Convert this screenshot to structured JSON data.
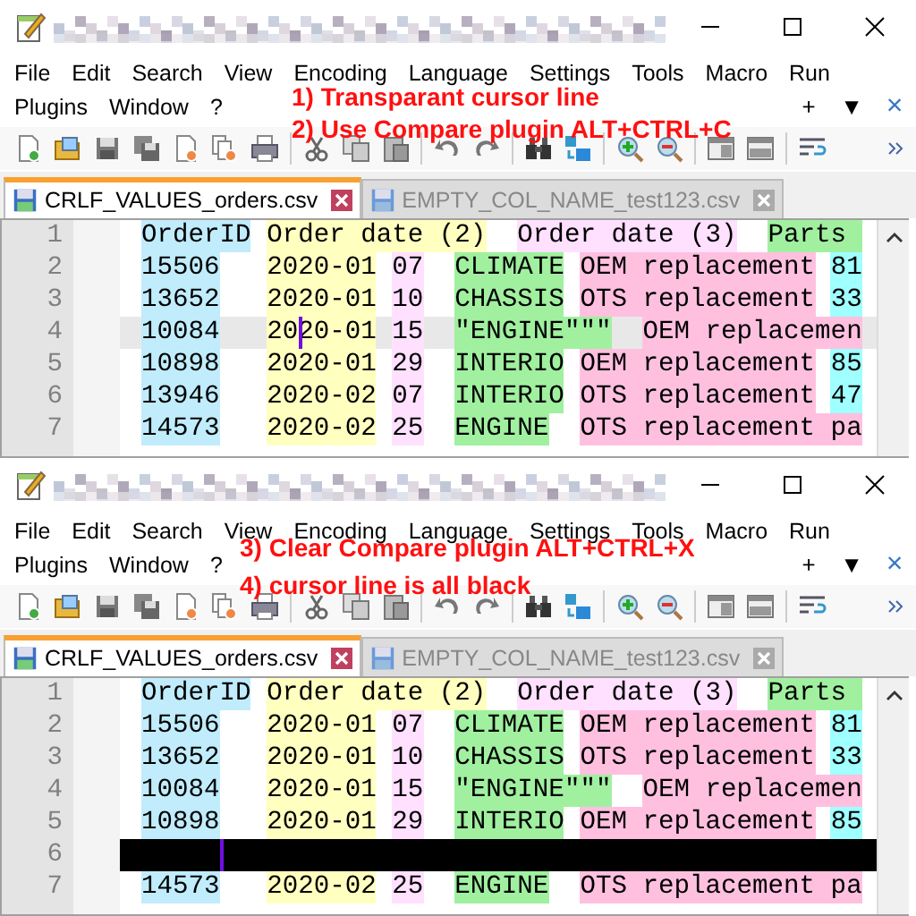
{
  "panes": [
    {
      "menu_rows": [
        [
          "File",
          "Edit",
          "Search",
          "View",
          "Encoding",
          "Language",
          "Settings",
          "Tools",
          "Macro",
          "Run"
        ],
        [
          "Plugins",
          "Window",
          "?"
        ]
      ],
      "menu_right": [
        "+",
        "▼",
        "×"
      ],
      "annotations": [
        "1) Transparant cursor line",
        "2) Use Compare plugin ALT+CTRL+C"
      ],
      "tabs": [
        {
          "label": "CRLF_VALUES_orders.csv",
          "selected": true
        },
        {
          "label": "EMPTY_COL_NAME_test123.csv",
          "selected": false
        }
      ],
      "editor": {
        "cursor_line_black": false,
        "rows": [
          {
            "number": "1",
            "current": false,
            "runs": [
              {
                "text": "OrderID",
                "color": "#c0ecfc"
              },
              {
                "text": " Order date (2)",
                "color": "#ffffc0"
              },
              {
                "text": "  Order date (3)",
                "color": "#ffe0ff"
              },
              {
                "text": "  Parts ",
                "color": "#a0f0a0"
              }
            ]
          },
          {
            "number": "2",
            "current": false,
            "runs": [
              {
                "text": "15506",
                "color": "#c0ecfc"
              },
              {
                "text": "   2020-01",
                "color": "#ffffc0"
              },
              {
                "text": " 07",
                "color": "#ffe0ff"
              },
              {
                "text": "  CLIMATE",
                "color": "#a0f0a0"
              },
              {
                "text": " OEM replacement",
                "color": "#ffc0e0"
              },
              {
                "text": " 81",
                "color": "#a0ffff"
              }
            ]
          },
          {
            "number": "3",
            "current": false,
            "runs": [
              {
                "text": "13652",
                "color": "#c0ecfc"
              },
              {
                "text": "   2020-01",
                "color": "#ffffc0"
              },
              {
                "text": " 10",
                "color": "#ffe0ff"
              },
              {
                "text": "  CHASSIS",
                "color": "#a0f0a0"
              },
              {
                "text": " OTS replacement",
                "color": "#ffc0e0"
              },
              {
                "text": " 33",
                "color": "#a0ffff"
              }
            ]
          },
          {
            "number": "4",
            "current": true,
            "runs": [
              {
                "text": "10084",
                "color": "#c0ecfc"
              },
              {
                "text": "   20",
                "color": "#ffffc0"
              },
              {
                "kind": "caret"
              },
              {
                "text": "20-01",
                "color": "#ffffc0"
              },
              {
                "text": " 15",
                "color": "#ffe0ff"
              },
              {
                "text": "  \"ENGINE\"\"\"",
                "color": "#a0f0a0"
              },
              {
                "text": "  OEM replacemen",
                "color": "#ffc0e0"
              }
            ]
          },
          {
            "number": "5",
            "current": false,
            "runs": [
              {
                "text": "10898",
                "color": "#c0ecfc"
              },
              {
                "text": "   2020-01",
                "color": "#ffffc0"
              },
              {
                "text": " 29",
                "color": "#ffe0ff"
              },
              {
                "text": "  INTERIO",
                "color": "#a0f0a0"
              },
              {
                "text": " OEM replacement",
                "color": "#ffc0e0"
              },
              {
                "text": " 85",
                "color": "#a0ffff"
              }
            ]
          },
          {
            "number": "6",
            "current": false,
            "runs": [
              {
                "text": "13946",
                "color": "#c0ecfc"
              },
              {
                "text": "   2020-02",
                "color": "#ffffc0"
              },
              {
                "text": " 07",
                "color": "#ffe0ff"
              },
              {
                "text": "  INTERIO",
                "color": "#a0f0a0"
              },
              {
                "text": " OTS replacement",
                "color": "#ffc0e0"
              },
              {
                "text": " 47",
                "color": "#a0ffff"
              }
            ]
          },
          {
            "number": "7",
            "current": false,
            "runs": [
              {
                "text": "14573",
                "color": "#c0ecfc"
              },
              {
                "text": "   2020-02",
                "color": "#ffffc0"
              },
              {
                "text": " 25",
                "color": "#ffe0ff"
              },
              {
                "text": "  ENGINE",
                "color": "#a0f0a0"
              },
              {
                "text": "  OTS replacement pa",
                "color": "#ffc0e0"
              }
            ]
          }
        ]
      }
    },
    {
      "menu_rows": [
        [
          "File",
          "Edit",
          "Search",
          "View",
          "Encoding",
          "Language",
          "Settings",
          "Tools",
          "Macro",
          "Run"
        ],
        [
          "Plugins",
          "Window",
          "?"
        ]
      ],
      "menu_right": [
        "+",
        "▼",
        "×"
      ],
      "annotations": [
        "3) Clear Compare plugin ALT+CTRL+X",
        "4) cursor line is all black"
      ],
      "tabs": [
        {
          "label": "CRLF_VALUES_orders.csv",
          "selected": true
        },
        {
          "label": "EMPTY_COL_NAME_test123.csv",
          "selected": false
        }
      ],
      "editor": {
        "cursor_line_black": true,
        "rows": [
          {
            "number": "1",
            "current": false,
            "runs": [
              {
                "text": "OrderID",
                "color": "#c0ecfc"
              },
              {
                "text": " Order date (2)",
                "color": "#ffffc0"
              },
              {
                "text": "  Order date (3)",
                "color": "#ffe0ff"
              },
              {
                "text": "  Parts ",
                "color": "#a0f0a0"
              }
            ]
          },
          {
            "number": "2",
            "current": false,
            "runs": [
              {
                "text": "15506",
                "color": "#c0ecfc"
              },
              {
                "text": "   2020-01",
                "color": "#ffffc0"
              },
              {
                "text": " 07",
                "color": "#ffe0ff"
              },
              {
                "text": "  CLIMATE",
                "color": "#a0f0a0"
              },
              {
                "text": " OEM replacement",
                "color": "#ffc0e0"
              },
              {
                "text": " 81",
                "color": "#a0ffff"
              }
            ]
          },
          {
            "number": "3",
            "current": false,
            "runs": [
              {
                "text": "13652",
                "color": "#c0ecfc"
              },
              {
                "text": "   2020-01",
                "color": "#ffffc0"
              },
              {
                "text": " 10",
                "color": "#ffe0ff"
              },
              {
                "text": "  CHASSIS",
                "color": "#a0f0a0"
              },
              {
                "text": " OTS replacement",
                "color": "#ffc0e0"
              },
              {
                "text": " 33",
                "color": "#a0ffff"
              }
            ]
          },
          {
            "number": "4",
            "current": false,
            "runs": [
              {
                "text": "10084",
                "color": "#c0ecfc"
              },
              {
                "text": "   2020-01",
                "color": "#ffffc0"
              },
              {
                "text": " 15",
                "color": "#ffe0ff"
              },
              {
                "text": "  \"ENGINE\"\"\"",
                "color": "#a0f0a0"
              },
              {
                "text": "  OEM replacemen",
                "color": "#ffc0e0"
              }
            ]
          },
          {
            "number": "5",
            "current": false,
            "runs": [
              {
                "text": "10898",
                "color": "#c0ecfc"
              },
              {
                "text": "   2020-01",
                "color": "#ffffc0"
              },
              {
                "text": " 29",
                "color": "#ffe0ff"
              },
              {
                "text": "  INTERIO",
                "color": "#a0f0a0"
              },
              {
                "text": " OEM replacement",
                "color": "#ffc0e0"
              },
              {
                "text": " 85",
                "color": "#a0ffff"
              }
            ]
          },
          {
            "number": "6",
            "current": true,
            "runs": [
              {
                "kind": "caret"
              }
            ]
          },
          {
            "number": "7",
            "current": false,
            "runs": [
              {
                "text": "14573",
                "color": "#c0ecfc"
              },
              {
                "text": "   2020-02",
                "color": "#ffffc0"
              },
              {
                "text": " 25",
                "color": "#ffe0ff"
              },
              {
                "text": "  ENGINE",
                "color": "#a0f0a0"
              },
              {
                "text": "  OTS replacement pa",
                "color": "#ffc0e0"
              }
            ]
          }
        ]
      }
    }
  ]
}
